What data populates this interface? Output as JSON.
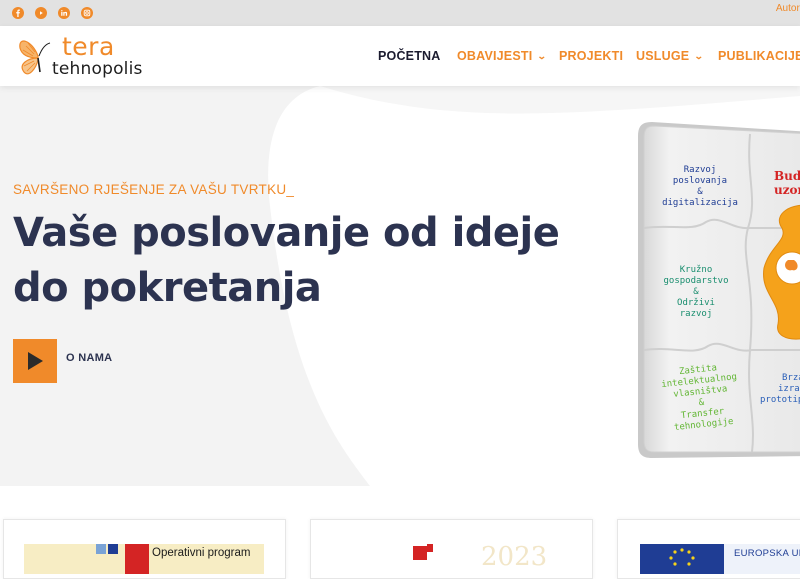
{
  "topbar": {
    "social_icons": [
      "facebook-icon",
      "youtube-icon",
      "linkedin-icon",
      "instagram-icon"
    ],
    "login_label": "Autori"
  },
  "logo": {
    "word1": "tera",
    "word2": "tehnopolis",
    "icon": "butterfly-icon"
  },
  "nav": {
    "items": [
      {
        "label": "POČETNA",
        "active": true,
        "dropdown": false
      },
      {
        "label": "OBAVIJESTI",
        "active": false,
        "dropdown": true
      },
      {
        "label": "PROJEKTI",
        "active": false,
        "dropdown": false
      },
      {
        "label": "USLUGE",
        "active": false,
        "dropdown": true
      },
      {
        "label": "PUBLIKACIJE",
        "active": false,
        "dropdown": false
      }
    ]
  },
  "hero": {
    "tagline": "SAVRŠENO RJEŠENJE ZA VAŠU TVRTKU_",
    "headline": "Vaše poslovanje od ideje do pokretanja",
    "play_label": "O NAMA",
    "box_labels": {
      "t1": "Razvoj\nposlovanja\n&\ndigitalizacija",
      "t2": "Kružno\ngospodarstvo\n&\nOdrživi\nrazvoj",
      "t3": "Zaštita\nintelektualnog\nvlasništva\n&\nTransfer\ntehnologije",
      "t4": "Budi\nuzor",
      "t5": "Brza\nizrada\nprototip"
    }
  },
  "cards": {
    "card1_text": "Operativni program",
    "card2_year": "2023",
    "card3_text": "EUROPSKA UNI"
  },
  "colors": {
    "accent": "#f08a2a",
    "dark": "#2c3350",
    "topbar_bg": "#e2e2e2",
    "hero_gray": "#f3f3f3"
  }
}
